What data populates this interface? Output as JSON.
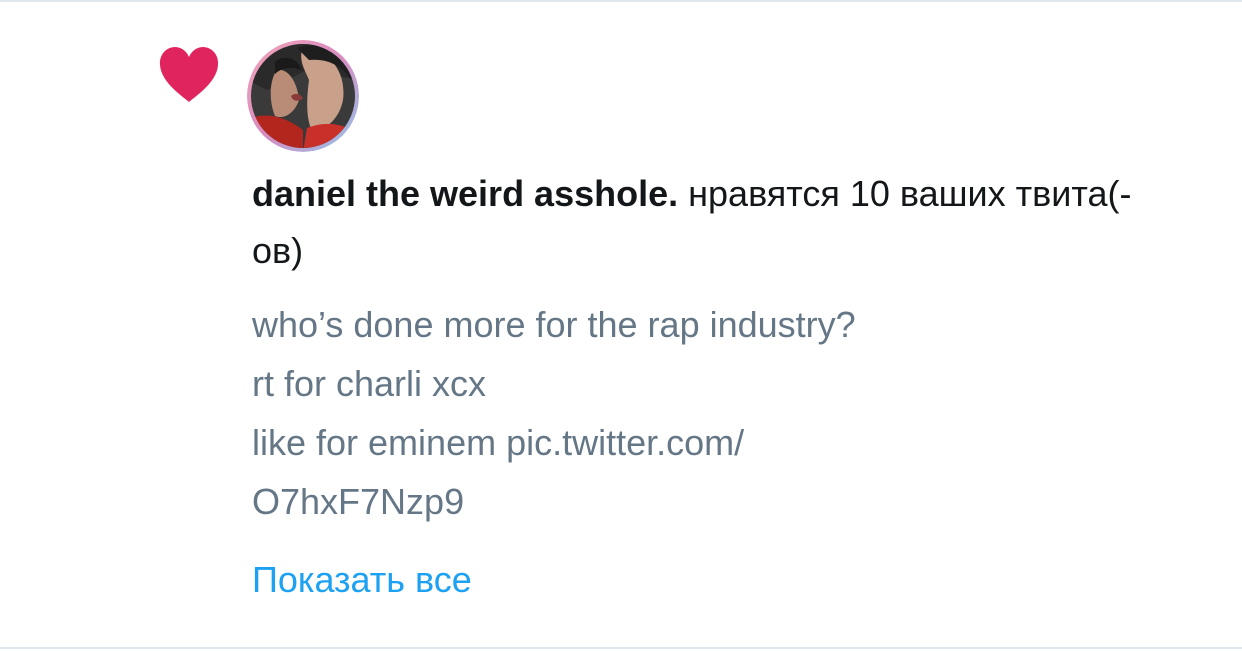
{
  "notification": {
    "user_name": "daniel the weird asshole.",
    "action_text": " нравятся 10 ваших твита(-ов)"
  },
  "tweet": {
    "lines": [
      "who’s done more for the rap industry?",
      "rt for charli xcx",
      "like for eminem pic.twitter.com/",
      "O7hxF7Nzp9"
    ]
  },
  "show_all_label": "Показать все",
  "colors": {
    "heart": "#e0245e",
    "primary_text": "#14171a",
    "secondary_text": "#657786",
    "link": "#1da1f2"
  },
  "icons": {
    "like": "heart-icon"
  }
}
